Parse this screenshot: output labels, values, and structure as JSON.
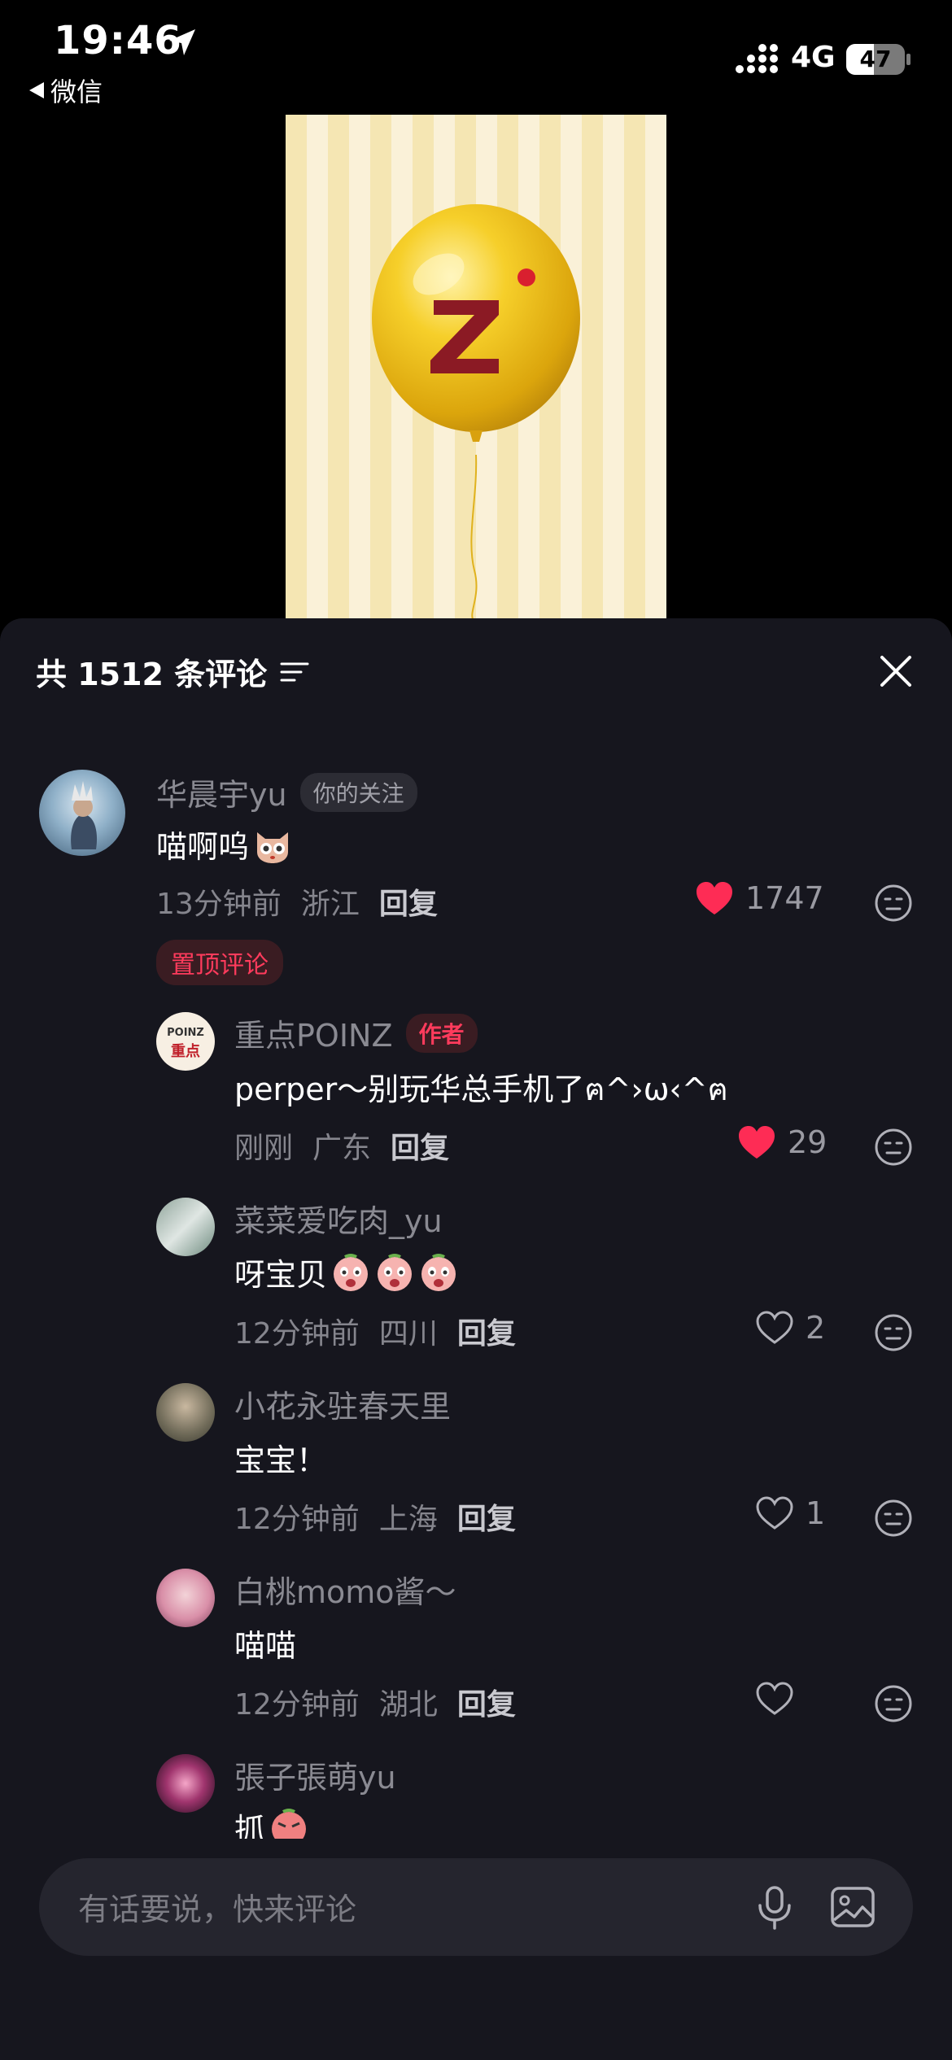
{
  "status_bar": {
    "time": "19:46",
    "back_app": "微信",
    "network": "4G",
    "battery": "47",
    "battery_level": 0.47
  },
  "sheet": {
    "title": "共 1512 条评论"
  },
  "comments": [
    {
      "username": "华晨宇yu",
      "tag": "你的关注",
      "text": "喵啊呜",
      "time": "13分钟前",
      "location": "浙江",
      "reply_label": "回复",
      "likes": "1747",
      "liked": true,
      "pinned_label": "置顶评论"
    },
    {
      "username": "重点POINZ",
      "tag": "作者",
      "avatar_text_1": "POINZ",
      "avatar_text_2": "重点",
      "text": "perper～别玩华总手机了ฅ^›ω‹^ฅ",
      "time": "刚刚",
      "location": "广东",
      "reply_label": "回复",
      "likes": "29",
      "liked": true
    },
    {
      "username": "菜菜爱吃肉_yu",
      "text": "呀宝贝",
      "time": "12分钟前",
      "location": "四川",
      "reply_label": "回复",
      "likes": "2",
      "liked": false
    },
    {
      "username": "小花永驻春天里",
      "text": "宝宝！",
      "time": "12分钟前",
      "location": "上海",
      "reply_label": "回复",
      "likes": "1",
      "liked": false
    },
    {
      "username": "白桃momo酱～",
      "text": "喵喵",
      "time": "12分钟前",
      "location": "湖北",
      "reply_label": "回复",
      "likes": "",
      "liked": false
    },
    {
      "username": "張子張萌yu",
      "text": "抓"
    }
  ],
  "input": {
    "placeholder": "有话要说，快来评论"
  },
  "colors": {
    "sheet_bg": "#16161e",
    "accent_red": "#ff3b5c",
    "like_red": "#fe2c55",
    "balloon_yellow": "#f2c21b",
    "logo_dark_red": "#8b1a24"
  },
  "icons": [
    "location-arrow-icon",
    "signal-icon",
    "battery-icon",
    "sort-icon",
    "close-icon",
    "heart-icon",
    "more-face-icon",
    "mic-icon",
    "image-icon"
  ]
}
